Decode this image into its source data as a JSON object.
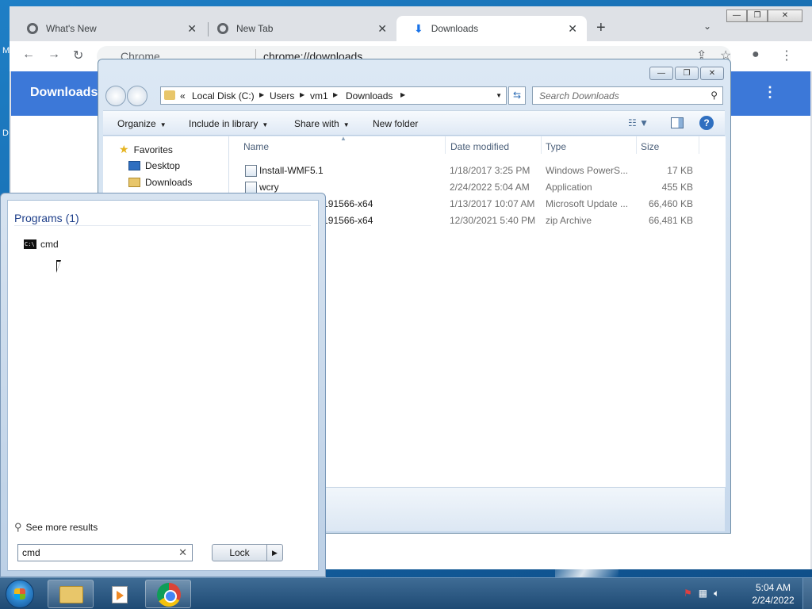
{
  "desktop": {
    "letters": [
      "M",
      "D"
    ]
  },
  "chrome": {
    "tabs": [
      {
        "label": "What's New",
        "close": "✕"
      },
      {
        "label": "New Tab",
        "close": "✕"
      },
      {
        "label": "Downloads",
        "close": "✕"
      }
    ],
    "new_tab": "+",
    "tab_search": "⌄",
    "window_controls": {
      "minimize": "—",
      "restore": "❐",
      "close": "✕"
    },
    "toolbar": {
      "back": "←",
      "forward": "→",
      "reload": "↻",
      "share": "⇪",
      "bookmark": "☆",
      "profile": "●",
      "menu": "⋮"
    },
    "omnibox": {
      "site": "Chrome",
      "url": "chrome://downloads"
    },
    "page": {
      "title": "Downloads",
      "menu": "⋮"
    }
  },
  "explorer": {
    "window_controls": {
      "minimize": "—",
      "restore": "❐",
      "close": "✕"
    },
    "breadcrumb": [
      "Local Disk (C:)",
      "Users",
      "vm1",
      "Downloads"
    ],
    "breadcrumb_prefix": "«",
    "search_placeholder": "Search Downloads",
    "commands": {
      "organize": "Organize",
      "include": "Include in library",
      "share": "Share with",
      "new_folder": "New folder"
    },
    "nav": {
      "favorites": "Favorites",
      "items": [
        "Desktop",
        "Downloads"
      ]
    },
    "columns": {
      "name": "Name",
      "date": "Date modified",
      "type": "Type",
      "size": "Size"
    },
    "files": [
      {
        "name": "Install-WMF5.1",
        "date": "1/18/2017 3:25 PM",
        "type": "Windows PowerS...",
        "size": "17 KB"
      },
      {
        "name": "wcry",
        "date": "2/24/2022 5:04 AM",
        "type": "Application",
        "size": "455 KB"
      },
      {
        "name": "R2-KB3191566-x64",
        "date": "1/13/2017 10:07 AM",
        "type": "Microsoft Update ...",
        "size": "66,460 KB"
      },
      {
        "name": "R2-KB3191566-x64",
        "date": "12/30/2021 5:40 PM",
        "type": "zip Archive",
        "size": "66,481 KB"
      }
    ]
  },
  "startmenu": {
    "programs_header": "Programs (1)",
    "results": [
      {
        "label": "cmd",
        "icon": "C:\\"
      }
    ],
    "see_more": "See more results",
    "search_value": "cmd",
    "clear": "✕",
    "lock_label": "Lock",
    "lock_arrow": "▶"
  },
  "taskbar": {
    "tray_icons": [
      "action-center-icon",
      "network-icon",
      "volume-icon"
    ],
    "time": "5:04 AM",
    "date": "2/24/2022"
  }
}
